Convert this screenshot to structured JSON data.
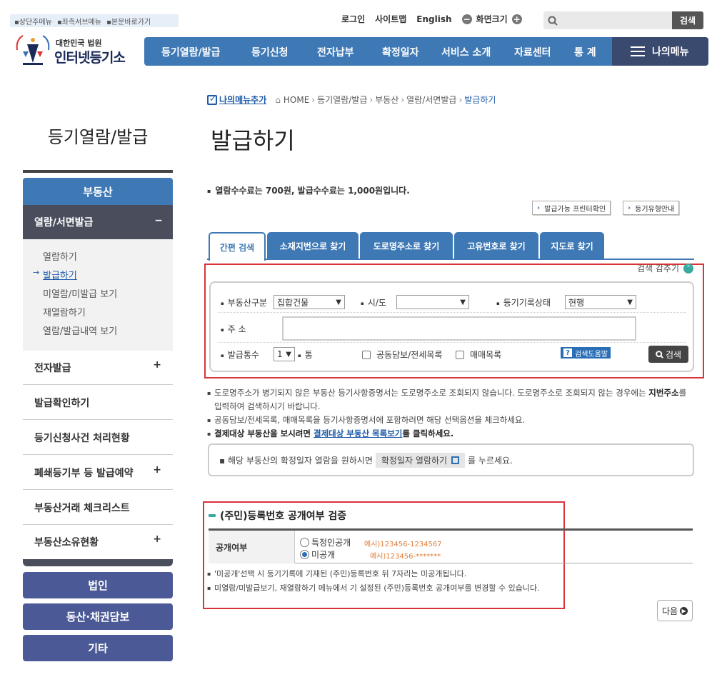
{
  "skipnav": [
    "▪상단주메뉴",
    "▪좌측서브메뉴",
    "▪본문바로가기"
  ],
  "util": {
    "login": "로그인",
    "sitemap": "사이트맵",
    "english": "English",
    "zoom": "화면크기",
    "zoom_out": "−",
    "zoom_in": "+"
  },
  "search": {
    "placeholder": "",
    "button": "검색"
  },
  "logo": {
    "top": "대한민국 법원",
    "main": "인터넷등기소"
  },
  "gnb": [
    "등기열람/발급",
    "등기신청",
    "전자납부",
    "확정일자",
    "서비스 소개",
    "자료센터",
    "통 계"
  ],
  "mymenu": "나의메뉴",
  "lnb": {
    "title": "등기열람/발급",
    "head": "부동산",
    "selected": "열람/서면발급",
    "selected_toggle": "−",
    "sub": [
      "열람하기",
      "발급하기",
      "미열람/미발급 보기",
      "재열람하기",
      "열람/발급내역 보기"
    ],
    "items": [
      {
        "label": "전자발급",
        "toggle": "+"
      },
      {
        "label": "발급확인하기",
        "toggle": ""
      },
      {
        "label": "등기신청사건 처리현황",
        "toggle": ""
      },
      {
        "label": "폐쇄등기부 등 발급예약",
        "toggle": "+"
      },
      {
        "label": "부동산거래 체크리스트",
        "toggle": ""
      },
      {
        "label": "부동산소유현황",
        "toggle": "+"
      }
    ],
    "buttons": [
      "법인",
      "동산·채권담보",
      "기타"
    ]
  },
  "breadcrumb": {
    "add": "나의메뉴추가",
    "items": [
      "HOME",
      "등기열람/발급",
      "부동산",
      "열람/서면발급"
    ],
    "current": "발급하기",
    "sep": "›"
  },
  "page_title": "발급하기",
  "fee_notice": "열람수수료는 700원, 발급수수료는 1,000원입니다.",
  "top_buttons": [
    "발급가능 프린터확인",
    "등기유형안내"
  ],
  "tabs": [
    "간편 검색",
    "소재지번으로 찾기",
    "도로명주소로 찾기",
    "고유번호로 찾기",
    "지도로 찾기"
  ],
  "fold": "검색 감추기",
  "fold_icon": "⌃",
  "form": {
    "type_label": "부동산구분",
    "type_value": "집합건물",
    "sido_label": "시/도",
    "sido_value": "",
    "status_label": "등기기록상태",
    "status_value": "현행",
    "addr_label": "주 소",
    "addr_value": "",
    "count_label": "발급통수",
    "count_value": "1",
    "count_unit": "통",
    "opt1": "공동담보/전세목록",
    "opt2": "매매목록",
    "help": "검색도움말",
    "help_icon": "?",
    "search_btn": "검색"
  },
  "notes": {
    "line1a": "도로명주소가 병기되지 않은 부동산 등기사항증명서는 도로명주소로 조회되지 않습니다. 도로명주소로 조회되지 않는 경우에는 ",
    "line1b": "지번주소",
    "line1c": "를 입력하여 검색하시기 바랍니다.",
    "line2": "공동담보/전세목록, 매매목록을 등기사항증명서에 포함하려면 해당 선택옵션을 체크하세요.",
    "line3a": "결제대상 부동산을 보시려면 ",
    "line3b": "결제대상 부동산 목록보기",
    "line3c": "를 클릭하세요."
  },
  "notice": {
    "pre": "▪ 해당 부동산의 확정일자 열람을 원하시면",
    "button": "확정일자 열람하기",
    "post": "를 누르세요."
  },
  "rn": {
    "title": "(주민)등록번호 공개여부 검증",
    "th": "공개여부",
    "opt1": "특정인공개",
    "opt1_eg": "예시)123456-1234567",
    "opt2": "미공개",
    "opt2_eg": "예시)123456-*******",
    "note1": "'미공개'선택 시 등기기록에 기재된 (주민)등록번호 뒤 7자리는 미공개됩니다.",
    "note2": "미열람/미발급보기, 재열람하기 메뉴에서 기 설정된 (주민)등록번호 공개여부를 변경할 수 있습니다."
  },
  "next": "다음",
  "colors": {
    "primary": "#3e79b5",
    "dark": "#4a4e5c",
    "navy": "#4b5a96",
    "highlight": "#d9343a"
  }
}
